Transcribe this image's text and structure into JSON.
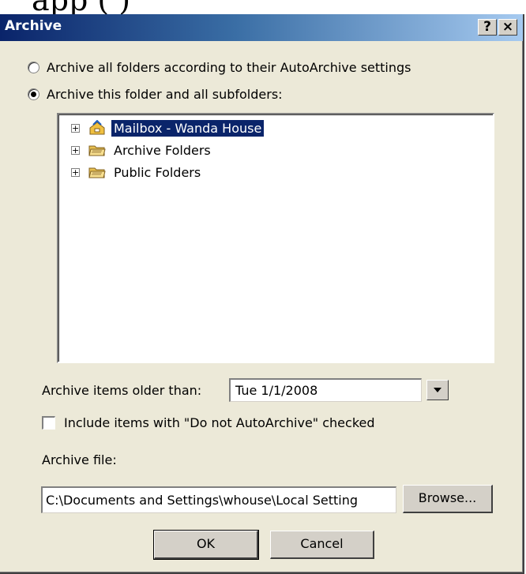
{
  "top_fragment": "app (   )",
  "dialog": {
    "title": "Archive",
    "help_button": "?",
    "close_button": "×"
  },
  "options": {
    "radio_all": {
      "label": "Archive all folders according to their AutoArchive settings",
      "checked": false
    },
    "radio_this": {
      "label": "Archive this folder and all subfolders:",
      "checked": true
    }
  },
  "tree": {
    "items": [
      {
        "label": "Mailbox - Wanda House",
        "icon": "mailbox-icon",
        "selected": true
      },
      {
        "label": "Archive Folders",
        "icon": "folder-icon",
        "selected": false
      },
      {
        "label": "Public Folders",
        "icon": "folder-icon",
        "selected": false
      }
    ]
  },
  "older_than": {
    "label": "Archive items older than:",
    "value": "Tue 1/1/2008"
  },
  "include_checkbox": {
    "label": "Include items with \"Do not AutoArchive\" checked",
    "checked": false
  },
  "archive_file": {
    "label": "Archive file:",
    "value": "C:\\Documents and Settings\\whouse\\Local Setting",
    "browse_label": "Browse..."
  },
  "buttons": {
    "ok": "OK",
    "cancel": "Cancel"
  },
  "colors": {
    "dialog_bg": "#ece9d8",
    "title_start": "#0a246a",
    "title_end": "#a6caf0",
    "selection": "#0a246a"
  }
}
